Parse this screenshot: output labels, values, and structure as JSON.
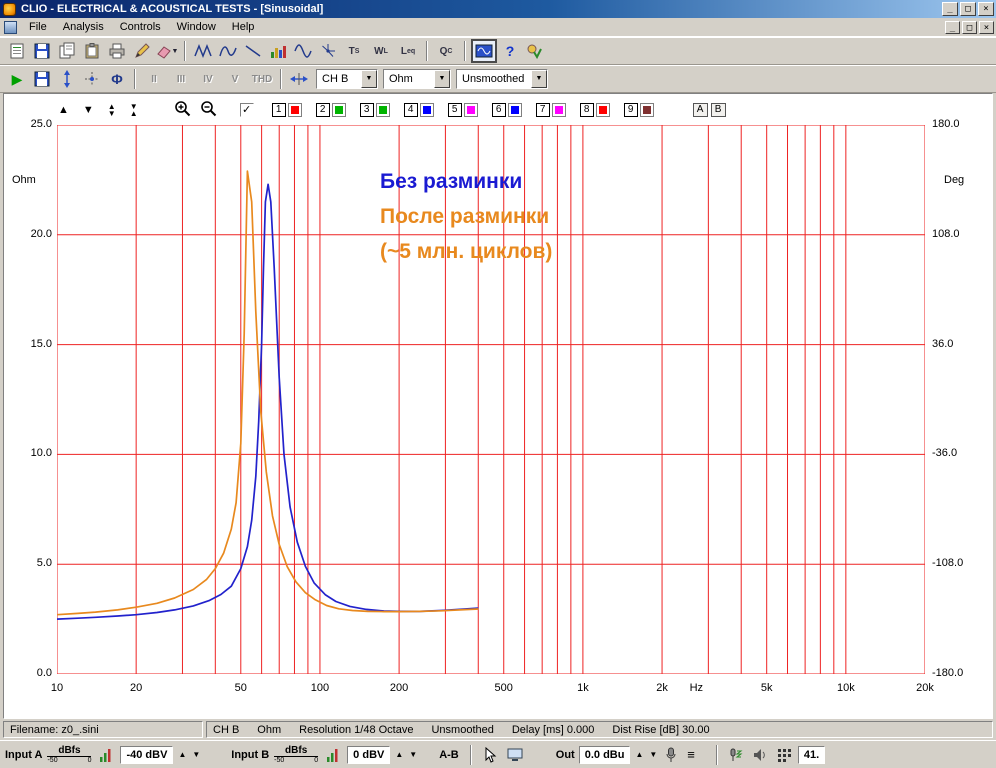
{
  "window": {
    "title": "CLIO - ELECTRICAL & ACOUSTICAL TESTS - [Sinusoidal]"
  },
  "icons": {
    "minimize": "_",
    "maximize": "□",
    "close": "×",
    "dropdown": "▼",
    "check": "✓",
    "up": "▲",
    "down": "▼",
    "menu": "≡",
    "phi": "Φ",
    "help": "?",
    "play": "▶"
  },
  "menu": {
    "items": [
      "File",
      "Analysis",
      "Controls",
      "Window",
      "Help"
    ]
  },
  "toolbar_main": {
    "analysis_labels": {
      "ts": {
        "m": "T",
        "s": "S"
      },
      "wl": {
        "m": "W",
        "s": "L"
      },
      "leq": {
        "m": "L",
        "s": "eq"
      },
      "qc": {
        "m": "Q",
        "s": "C"
      }
    }
  },
  "toolbar_meas": {
    "harmonics": [
      "II",
      "III",
      "IV",
      "V",
      "THD"
    ],
    "channel": "CH B",
    "unit": "Ohm",
    "smoothing": "Unsmoothed"
  },
  "graph_toolbar": {
    "slots": [
      {
        "n": "1",
        "color": "#ff0000"
      },
      {
        "n": "2",
        "color": "#00b400"
      },
      {
        "n": "3",
        "color": "#00b400"
      },
      {
        "n": "4",
        "color": "#0000ff"
      },
      {
        "n": "5",
        "color": "#ff00ff"
      },
      {
        "n": "6",
        "color": "#0000ff"
      },
      {
        "n": "7",
        "color": "#ff00ff"
      },
      {
        "n": "8",
        "color": "#ff0000"
      },
      {
        "n": "9",
        "color": "#803030"
      }
    ],
    "ab": [
      "A",
      "B"
    ]
  },
  "plot": {
    "left_unit": "Ohm",
    "right_unit": "Deg",
    "legend": [
      {
        "text": "Без разминки",
        "color": "#1a1ad2"
      },
      {
        "text": "После разминки",
        "color": "#e8891e"
      },
      {
        "text": "(~5 млн. циклов)",
        "color": "#e8891e"
      }
    ]
  },
  "chart_data": {
    "type": "line",
    "title": "Impedance magnitude vs frequency",
    "xlabel": "Hz",
    "ylabel_left": "Ohm",
    "ylabel_right": "Deg",
    "x_scale": "log",
    "xlim": [
      10,
      20000
    ],
    "ylim_left": [
      0,
      25
    ],
    "ylim_right": [
      -180,
      180
    ],
    "grid": true,
    "grid_color": "#ee2222",
    "y_gridlines": [
      0,
      5,
      10,
      15,
      20,
      25
    ],
    "y_ticks_left": [
      {
        "label": "25.0",
        "v": 25
      },
      {
        "label": "20.0",
        "v": 20
      },
      {
        "label": "15.0",
        "v": 15
      },
      {
        "label": "10.0",
        "v": 10
      },
      {
        "label": "5.0",
        "v": 5
      },
      {
        "label": "0.0",
        "v": 0
      }
    ],
    "y_ticks_right": [
      "180.0",
      "108.0",
      "36.0",
      "-36.0",
      "-108.0",
      "-180.0"
    ],
    "x_ticks": [
      {
        "label": "10",
        "f": 10
      },
      {
        "label": "20",
        "f": 20
      },
      {
        "label": "50",
        "f": 50
      },
      {
        "label": "100",
        "f": 100
      },
      {
        "label": "200",
        "f": 200
      },
      {
        "label": "500",
        "f": 500
      },
      {
        "label": "1k",
        "f": 1000
      },
      {
        "label": "2k",
        "f": 2000
      },
      {
        "label": "Hz",
        "f": 2700
      },
      {
        "label": "5k",
        "f": 5000
      },
      {
        "label": "10k",
        "f": 10000
      },
      {
        "label": "20k",
        "f": 20000
      }
    ],
    "legend": [
      "Без разминки",
      "После разминки (~5 млн. циклов)"
    ],
    "series": [
      {
        "name": "Без разминки",
        "color": "#2222cc",
        "x": [
          10,
          12,
          14,
          17,
          20,
          24,
          28,
          33,
          38,
          42,
          46,
          50,
          53,
          55,
          57,
          58.5,
          60,
          61,
          62,
          63.5,
          65,
          67,
          70,
          73,
          77,
          82,
          88,
          95,
          105,
          115,
          130,
          150,
          175,
          200,
          240,
          290,
          340,
          400
        ],
        "y": [
          2.5,
          2.54,
          2.58,
          2.64,
          2.7,
          2.8,
          2.92,
          3.1,
          3.35,
          3.62,
          4.0,
          4.8,
          5.8,
          7.0,
          9.0,
          11.5,
          15.0,
          18.5,
          21.5,
          22.3,
          21.5,
          18.5,
          13.5,
          10.0,
          7.6,
          6.0,
          4.9,
          4.15,
          3.6,
          3.3,
          3.08,
          2.94,
          2.87,
          2.85,
          2.85,
          2.89,
          2.94,
          3.0
        ]
      },
      {
        "name": "После разминки (~5 млн. циклов)",
        "color": "#e8891e",
        "x": [
          10,
          12,
          14,
          17,
          20,
          24,
          28,
          33,
          37,
          40,
          43,
          46,
          48,
          50,
          51.5,
          53,
          55,
          57,
          59.5,
          62.5,
          66,
          70,
          75,
          81,
          88,
          96,
          106,
          118,
          133,
          152,
          175,
          200,
          240,
          290,
          340,
          400
        ],
        "y": [
          2.7,
          2.76,
          2.82,
          2.92,
          3.04,
          3.22,
          3.46,
          3.85,
          4.3,
          4.8,
          5.5,
          6.6,
          7.8,
          10.5,
          15.5,
          22.9,
          21.5,
          16.5,
          12.0,
          9.2,
          7.2,
          5.9,
          4.9,
          4.2,
          3.7,
          3.38,
          3.12,
          2.97,
          2.89,
          2.85,
          2.84,
          2.84,
          2.85,
          2.88,
          2.92,
          2.96
        ]
      }
    ]
  },
  "statusbar": {
    "filename": "Filename: z0_.sini",
    "segments": [
      "CH B",
      "Ohm",
      "Resolution 1/48 Octave",
      "Unsmoothed",
      "Delay [ms] 0.000",
      "Dist Rise [dB] 30.00"
    ]
  },
  "io_bar": {
    "input_a": {
      "label": "Input A",
      "unit": "dBfs",
      "scale_min": "-50",
      "scale_max": "0",
      "value": "-40 dBV"
    },
    "input_b": {
      "label": "Input B",
      "unit": "dBfs",
      "scale_min": "-50",
      "scale_max": "0",
      "value": "0 dBV"
    },
    "ab_button": "A-B",
    "out_label": "Out",
    "out_value": "0.0 dBu",
    "right_value": "41."
  }
}
